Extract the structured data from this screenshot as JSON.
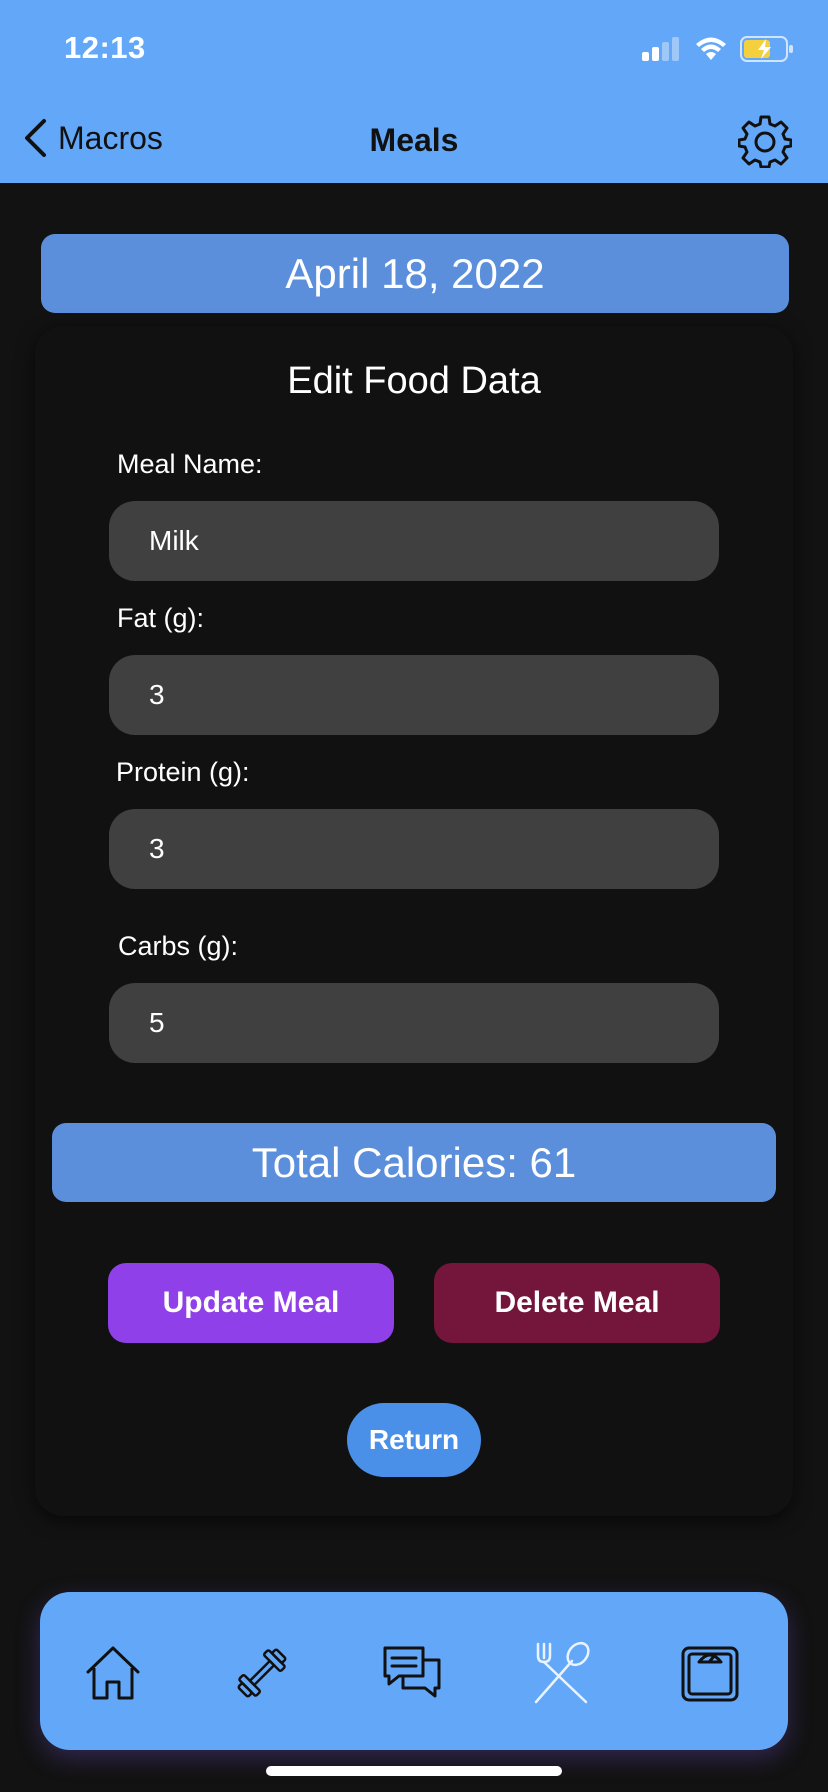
{
  "status_bar": {
    "time": "12:13"
  },
  "nav": {
    "back_label": "Macros",
    "title": "Meals"
  },
  "date_banner": "April 18, 2022",
  "form": {
    "title": "Edit Food Data",
    "fields": [
      {
        "label": "Meal Name:",
        "value": "Milk"
      },
      {
        "label": "Fat (g):",
        "value": "3"
      },
      {
        "label": "Protein (g):",
        "value": "3"
      },
      {
        "label": "Carbs (g):",
        "value": "5"
      }
    ]
  },
  "total": "Total Calories: 61",
  "buttons": {
    "update": "Update Meal",
    "delete": "Delete Meal",
    "return": "Return"
  },
  "tabs": [
    {
      "icon": "home-icon"
    },
    {
      "icon": "dumbbell-icon"
    },
    {
      "icon": "chat-icon"
    },
    {
      "icon": "fork-spoon-icon"
    },
    {
      "icon": "scale-icon"
    }
  ],
  "colors": {
    "header": "#63a8f8",
    "banner": "#5b8fdc",
    "background": "#121212",
    "input": "#404040",
    "update_button": "#9040e8",
    "delete_button": "#74153c",
    "return_button": "#4a90e8"
  }
}
